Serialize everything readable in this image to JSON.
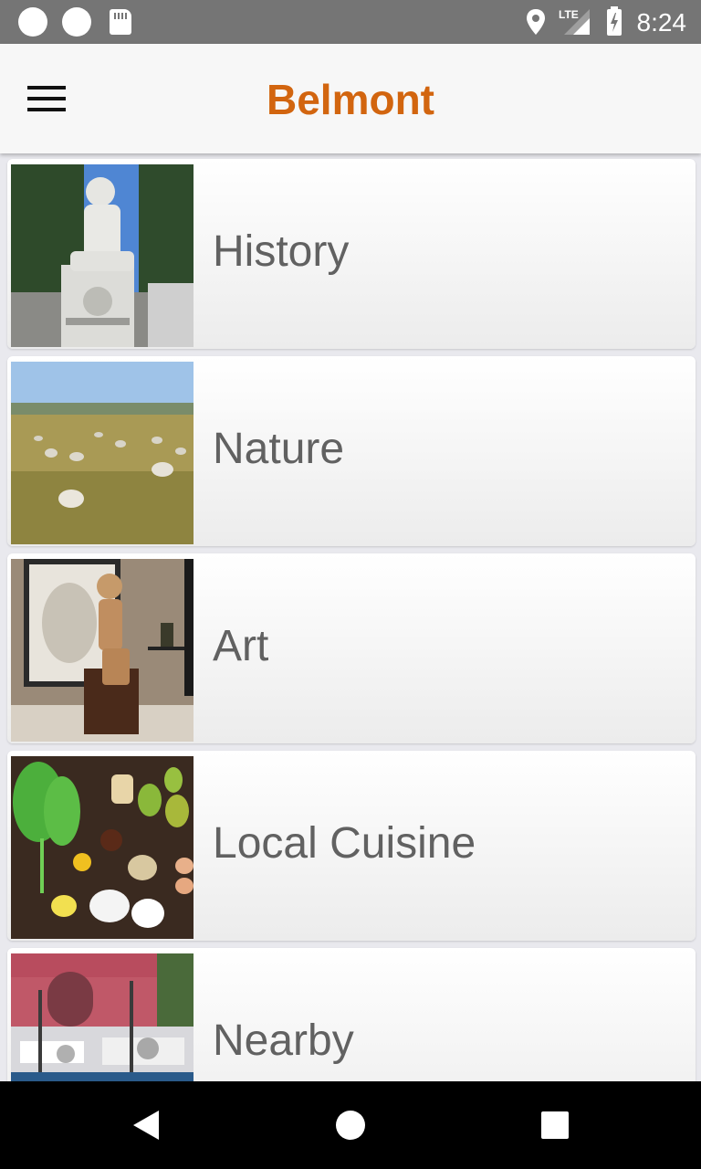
{
  "status_bar": {
    "time": "8:24",
    "network": "LTE",
    "icons": [
      "notification-dot",
      "notification-dot",
      "sd-card",
      "location",
      "lte-signal",
      "battery-charging"
    ]
  },
  "app_bar": {
    "title": "Belmont",
    "title_color": "#d2650f",
    "menu_icon": "hamburger-menu"
  },
  "categories": [
    {
      "label": "History",
      "image": "marble statue at cemetery"
    },
    {
      "label": "Nature",
      "image": "sheep grazing in field"
    },
    {
      "label": "Art",
      "image": "sculpture of seated girl in gallery"
    },
    {
      "label": "Local Cuisine",
      "image": "pears, greens and ingredients on table"
    },
    {
      "label": "Nearby",
      "image": "harbor with boats"
    }
  ],
  "nav_bar": {
    "buttons": [
      "back",
      "home",
      "recents"
    ]
  }
}
